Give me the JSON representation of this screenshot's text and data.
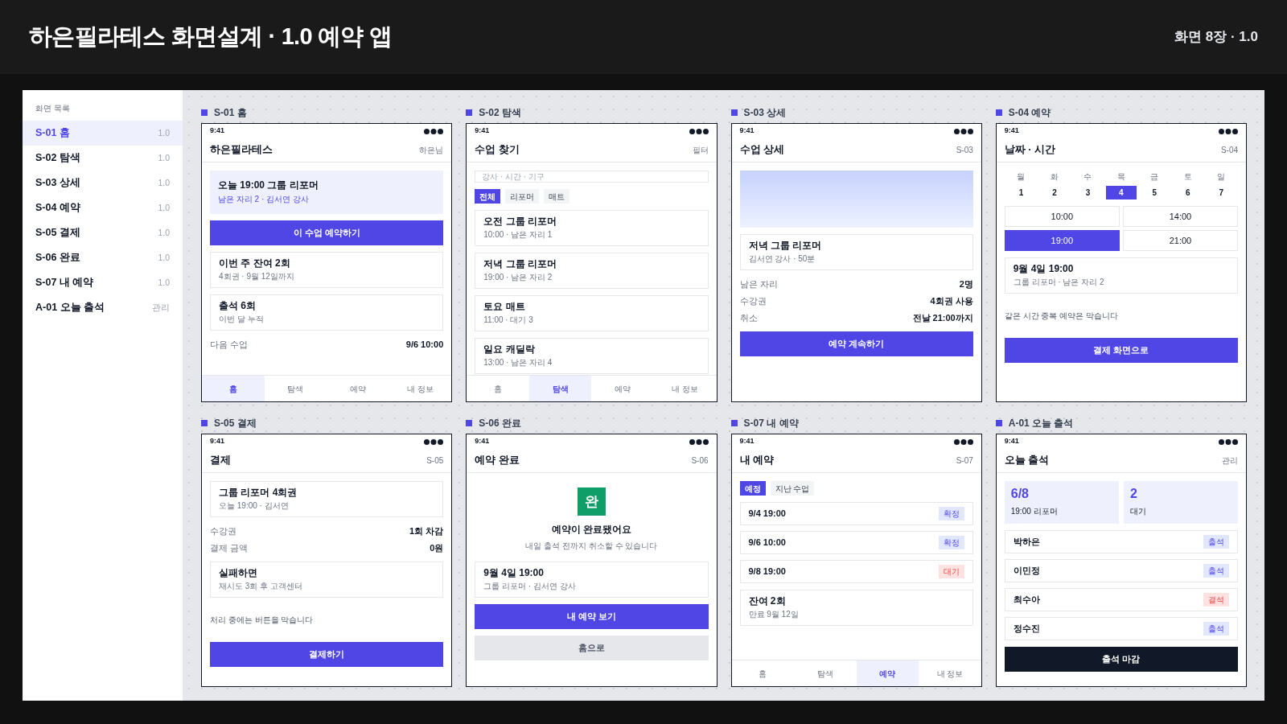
{
  "header": {
    "title": "하은필라테스 화면설계 · 1.0 예약 앱",
    "meta": "화면 8장 · 1.0"
  },
  "sidebar": {
    "title": "화면 목록",
    "items": [
      {
        "label": "S-01 홈",
        "version": "1.0",
        "selected": true
      },
      {
        "label": "S-02 탐색",
        "version": "1.0",
        "selected": false
      },
      {
        "label": "S-03 상세",
        "version": "1.0",
        "selected": false
      },
      {
        "label": "S-04 예약",
        "version": "1.0",
        "selected": false
      },
      {
        "label": "S-05 결제",
        "version": "1.0",
        "selected": false
      },
      {
        "label": "S-06 완료",
        "version": "1.0",
        "selected": false
      },
      {
        "label": "S-07 내 예약",
        "version": "1.0",
        "selected": false
      },
      {
        "label": "A-01 오늘 출석",
        "version": "관리",
        "selected": false
      }
    ]
  },
  "screens": [
    {
      "label": "S-01 홈",
      "time": "9:41",
      "title": "하은필라테스",
      "action": "하은님",
      "blocks": [
        {
          "kind": "highlight",
          "title": "오늘 19:00 그룹 리포머",
          "subtitle": "남은 자리 2 · 김서연 강사"
        },
        {
          "kind": "button",
          "label": "이 수업 예약하기"
        },
        {
          "kind": "card",
          "title": "이번 주 잔여 2회",
          "subtitle": "4회권 · 9월 12일까지"
        },
        {
          "kind": "card",
          "title": "출석 6회",
          "subtitle": "이번 달 누적"
        },
        {
          "kind": "details",
          "items": [
            {
              "label": "다음 수업",
              "value": "9/6 10:00"
            }
          ]
        }
      ],
      "tabbar": [
        {
          "label": "홈",
          "selected": true
        },
        {
          "label": "탐색",
          "selected": false
        },
        {
          "label": "예약",
          "selected": false
        },
        {
          "label": "내 정보",
          "selected": false
        }
      ]
    },
    {
      "label": "S-02 탐색",
      "time": "9:41",
      "title": "수업 찾기",
      "action": "필터",
      "blocks": [
        {
          "kind": "search",
          "placeholder": "강사 · 시간 · 기구"
        },
        {
          "kind": "chips",
          "items": [
            {
              "label": "전체",
              "selected": true
            },
            {
              "label": "리포머",
              "selected": false
            },
            {
              "label": "매트",
              "selected": false
            }
          ]
        },
        {
          "kind": "card",
          "title": "오전 그룹 리포머",
          "subtitle": "10:00 · 남은 자리 1"
        },
        {
          "kind": "card",
          "title": "저녁 그룹 리포머",
          "subtitle": "19:00 · 남은 자리 2"
        },
        {
          "kind": "card",
          "title": "토요 매트",
          "subtitle": "11:00 · 대기 3"
        },
        {
          "kind": "card",
          "title": "일요 캐딜락",
          "subtitle": "13:00 · 남은 자리 4"
        }
      ],
      "tabbar": [
        {
          "label": "홈",
          "selected": false
        },
        {
          "label": "탐색",
          "selected": true
        },
        {
          "label": "예약",
          "selected": false
        },
        {
          "label": "내 정보",
          "selected": false
        }
      ]
    },
    {
      "label": "S-03 상세",
      "time": "9:41",
      "title": "수업 상세",
      "action": "S-03",
      "blocks": [
        {
          "kind": "placeholder"
        },
        {
          "kind": "card",
          "title": "저녁 그룹 리포머",
          "subtitle": "김서연 강사 · 50분"
        },
        {
          "kind": "details",
          "items": [
            {
              "label": "남은 자리",
              "value": "2명"
            },
            {
              "label": "수강권",
              "value": "4회권 사용"
            },
            {
              "label": "취소",
              "value": "전날 21:00까지"
            }
          ]
        },
        {
          "kind": "button",
          "label": "예약 계속하기"
        }
      ]
    },
    {
      "label": "S-04 예약",
      "time": "9:41",
      "title": "날짜 · 시간",
      "action": "S-04",
      "blocks": [
        {
          "kind": "calendar",
          "days": [
            {
              "weekday": "월",
              "date": "1",
              "selected": false
            },
            {
              "weekday": "화",
              "date": "2",
              "selected": false
            },
            {
              "weekday": "수",
              "date": "3",
              "selected": false
            },
            {
              "weekday": "목",
              "date": "4",
              "selected": true
            },
            {
              "weekday": "금",
              "date": "5",
              "selected": false
            },
            {
              "weekday": "토",
              "date": "6",
              "selected": false
            },
            {
              "weekday": "일",
              "date": "7",
              "selected": false
            }
          ]
        },
        {
          "kind": "slots",
          "items": [
            {
              "label": "10:00",
              "selected": false
            },
            {
              "label": "14:00",
              "selected": false
            },
            {
              "label": "19:00",
              "selected": true
            },
            {
              "label": "21:00",
              "selected": false
            }
          ]
        },
        {
          "kind": "card",
          "title": "9월 4일 19:00",
          "subtitle": "그룹 리포머 · 남은 자리 2"
        },
        {
          "kind": "note",
          "text": "같은 시간 중복 예약은 막습니다"
        },
        {
          "kind": "button",
          "label": "결제 화면으로"
        }
      ]
    },
    {
      "label": "S-05 결제",
      "time": "9:41",
      "title": "결제",
      "action": "S-05",
      "blocks": [
        {
          "kind": "card",
          "title": "그룹 리포머 4회권",
          "subtitle": "오늘 19:00 · 김서연"
        },
        {
          "kind": "details",
          "items": [
            {
              "label": "수강권",
              "value": "1회 차감"
            },
            {
              "label": "결제 금액",
              "value": "0원"
            }
          ]
        },
        {
          "kind": "card",
          "title": "실패하면",
          "subtitle": "재시도 3회 후 고객센터"
        },
        {
          "kind": "note",
          "text": "처리 중에는 버튼을 막습니다"
        },
        {
          "kind": "button",
          "label": "결제하기"
        }
      ]
    },
    {
      "label": "S-06 완료",
      "time": "9:41",
      "title": "예약 완료",
      "action": "S-06",
      "blocks": [
        {
          "kind": "success",
          "icon": "완",
          "title": "예약이 완료됐어요",
          "subtitle": "내일 출석 전까지 취소할 수 있습니다"
        },
        {
          "kind": "card",
          "title": "9월 4일 19:00",
          "subtitle": "그룹 리포머 · 김서연 강사"
        },
        {
          "kind": "button",
          "label": "내 예약 보기"
        },
        {
          "kind": "secondary_button",
          "label": "홈으로"
        }
      ]
    },
    {
      "label": "S-07 내 예약",
      "time": "9:41",
      "title": "내 예약",
      "action": "S-07",
      "blocks": [
        {
          "kind": "chips",
          "items": [
            {
              "label": "예정",
              "selected": true
            },
            {
              "label": "지난 수업",
              "selected": false
            }
          ]
        },
        {
          "kind": "status_list",
          "items": [
            {
              "label": "9/4 19:00",
              "badge": "확정",
              "kind": "positive"
            },
            {
              "label": "9/6 10:00",
              "badge": "확정",
              "kind": "positive"
            },
            {
              "label": "9/8 19:00",
              "badge": "대기",
              "kind": "negative"
            }
          ]
        },
        {
          "kind": "card",
          "title": "잔여 2회",
          "subtitle": "만료 9월 12일"
        }
      ],
      "tabbar": [
        {
          "label": "홈",
          "selected": false
        },
        {
          "label": "탐색",
          "selected": false
        },
        {
          "label": "예약",
          "selected": true
        },
        {
          "label": "내 정보",
          "selected": false
        }
      ]
    },
    {
      "label": "A-01 오늘 출석",
      "time": "9:41",
      "title": "오늘 출석",
      "action": "관리",
      "blocks": [
        {
          "kind": "stats",
          "items": [
            {
              "value": "6/8",
              "label": "19:00 리포머"
            },
            {
              "value": "2",
              "label": "대기"
            }
          ]
        },
        {
          "kind": "status_list",
          "items": [
            {
              "label": "박하은",
              "badge": "출석",
              "kind": "positive"
            },
            {
              "label": "이민정",
              "badge": "출석",
              "kind": "positive"
            },
            {
              "label": "최수아",
              "badge": "결석",
              "kind": "negative"
            },
            {
              "label": "정수진",
              "badge": "출석",
              "kind": "positive"
            }
          ]
        },
        {
          "kind": "dark_button",
          "label": "출석 마감"
        }
      ]
    }
  ]
}
